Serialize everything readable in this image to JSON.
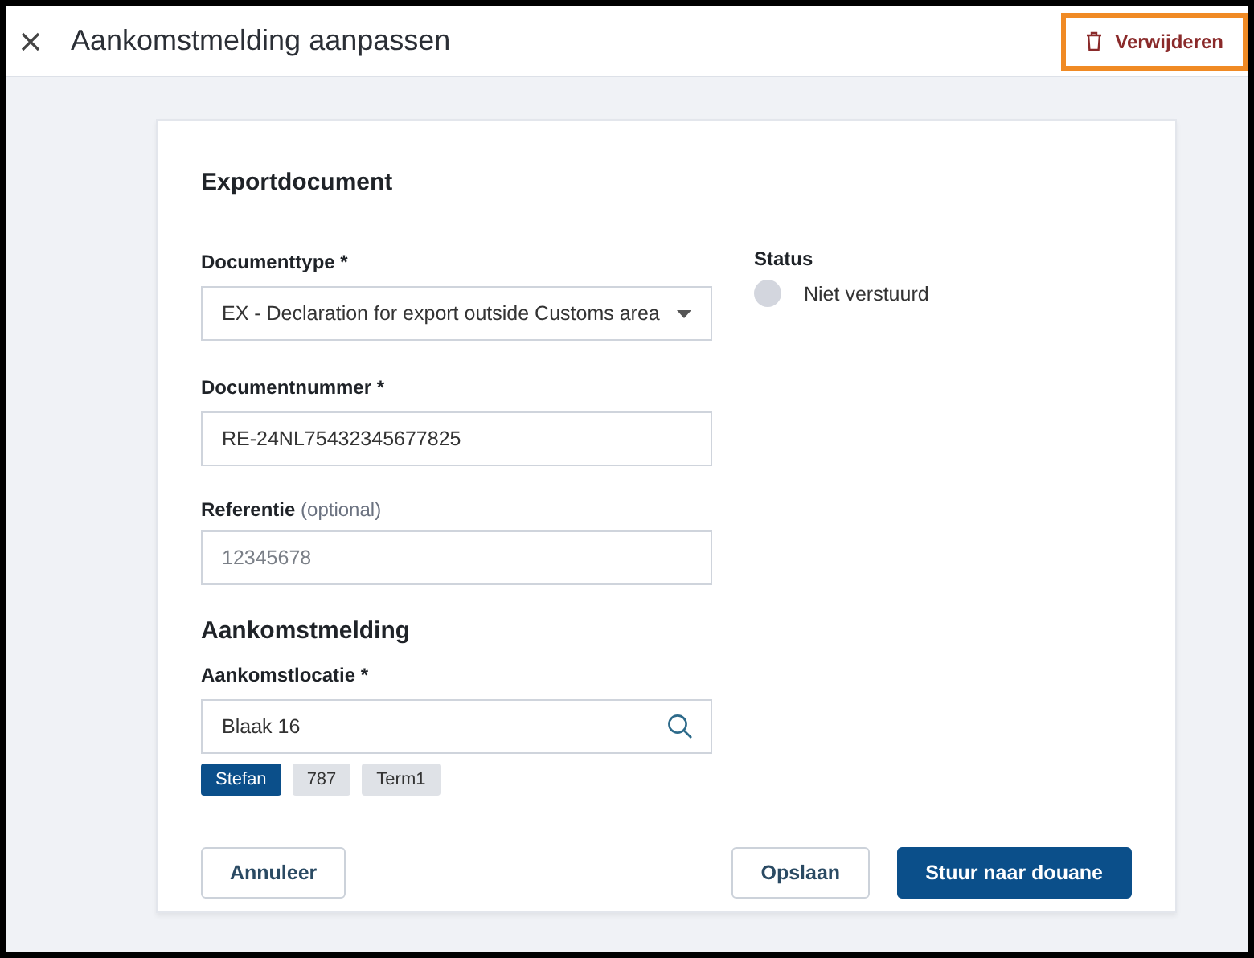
{
  "header": {
    "title": "Aankomstmelding aanpassen",
    "delete_button": {
      "label": "Verwijderen",
      "highlighted": true
    }
  },
  "form": {
    "section_title": "Exportdocument",
    "fields": [
      {
        "kind": "select",
        "label": "Documenttype *",
        "value": "EX - Declaration for export outside Customs area"
      },
      {
        "kind": "text",
        "label": "Documentnummer *",
        "value": "RE-24NL75432345677825"
      },
      {
        "kind": "text",
        "label": "Referentie",
        "hint": "(optional)",
        "placeholder": "12345678"
      }
    ],
    "status": {
      "label": "Status",
      "value": "Niet verstuurd",
      "color": "#d3d6de"
    },
    "arrival_title": "Aankomstmelding",
    "arrival_field": {
      "kind": "search",
      "label": "Aankomstlocatie *",
      "value": "Blaak 16"
    },
    "tags": [
      {
        "label": "Stefan",
        "selected": true
      },
      {
        "label": "787",
        "selected": false
      },
      {
        "label": "Term1",
        "selected": false
      }
    ],
    "buttons": [
      {
        "label": "Annuleer",
        "kind": "secondary"
      },
      {
        "label": "Opslaan",
        "kind": "secondary"
      },
      {
        "label": "Stuur naar douane",
        "kind": "primary"
      }
    ]
  }
}
